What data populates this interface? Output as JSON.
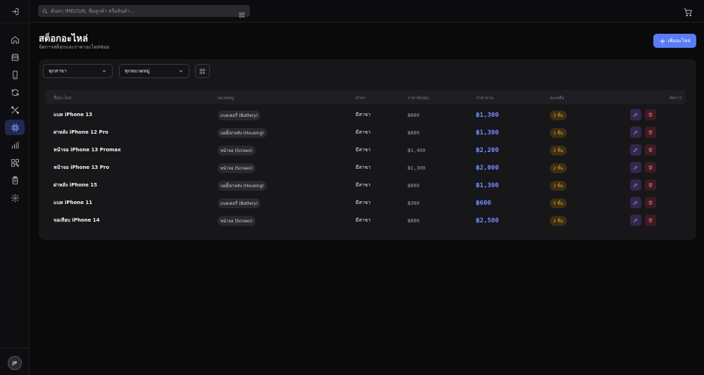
{
  "sidebar": {
    "items": [
      {
        "icon": "logout-icon"
      },
      {
        "icon": "home-icon"
      },
      {
        "icon": "store-icon"
      },
      {
        "icon": "phone-icon"
      },
      {
        "icon": "refresh-icon"
      },
      {
        "icon": "tools-icon"
      },
      {
        "icon": "chip-icon",
        "active": true
      },
      {
        "icon": "bar-chart-icon"
      },
      {
        "icon": "qr-icon"
      },
      {
        "icon": "clipboard-icon"
      },
      {
        "icon": "gear-icon"
      }
    ],
    "avatar_initials": "JP"
  },
  "topbar": {
    "search_placeholder": "ค้นหา IMEI/S/N, ชื่อลูกค้า หรือสินค้า..."
  },
  "header": {
    "title": "สต็อกอะไหล่",
    "subtitle": "จัดการสต็อกและราคาอะไหล่ซ่อม",
    "add_button": "เพิ่มอะไหล่"
  },
  "filters": {
    "branch": "ทุกสาขา",
    "category": "ทุกหมวดหมู่"
  },
  "table": {
    "headers": [
      "ชื่ออะไหล่",
      "หมวดหมู่",
      "สาขา",
      "ราคาต้นทุน",
      "ราคาขาย",
      "คงเหลือ",
      "จัดการ"
    ],
    "rows": [
      {
        "name": "แบต iPhone 13",
        "category": "แบตเตอรี่ (Battery)",
        "branch": "มีสาขา",
        "cost": "฿800",
        "price": "฿1,300",
        "stock": "3 ชิ้น"
      },
      {
        "name": "ฝาหลัง iPhone 12 Pro",
        "category": "บอดี้/ฝาหลัง (Housing)",
        "branch": "มีสาขา",
        "cost": "฿800",
        "price": "฿1,300",
        "stock": "1 ชิ้น"
      },
      {
        "name": "หน้าจอ iPhone 13 Promax",
        "category": "หน้าจอ (Screen)",
        "branch": "มีสาขา",
        "cost": "฿1,400",
        "price": "฿2,200",
        "stock": "2 ชิ้น"
      },
      {
        "name": "หน้าจอ iPhone 13 Pro",
        "category": "หน้าจอ (Screen)",
        "branch": "มีสาขา",
        "cost": "฿1,300",
        "price": "฿2,000",
        "stock": "2 ชิ้น"
      },
      {
        "name": "ฝาหลัง iPhone 15",
        "category": "บอดี้/ฝาหลัง (Housing)",
        "branch": "มีสาขา",
        "cost": "฿800",
        "price": "฿1,300",
        "stock": "2 ชิ้น"
      },
      {
        "name": "แบต iPhone 11",
        "category": "แบตเตอรี่ (Battery)",
        "branch": "มีสาขา",
        "cost": "฿300",
        "price": "฿600",
        "stock": "5 ชิ้น"
      },
      {
        "name": "จอเทียบ iPhone 14",
        "category": "หน้าจอ (Screen)",
        "branch": "มีสาขา",
        "cost": "฿800",
        "price": "฿2,500",
        "stock": "2 ชิ้น"
      }
    ]
  },
  "colors": {
    "accent": "#5b7cf5",
    "price": "#6f8dff",
    "stock_badge": "#e0a63a",
    "delete": "#f87171",
    "edit": "#a78bfa"
  }
}
